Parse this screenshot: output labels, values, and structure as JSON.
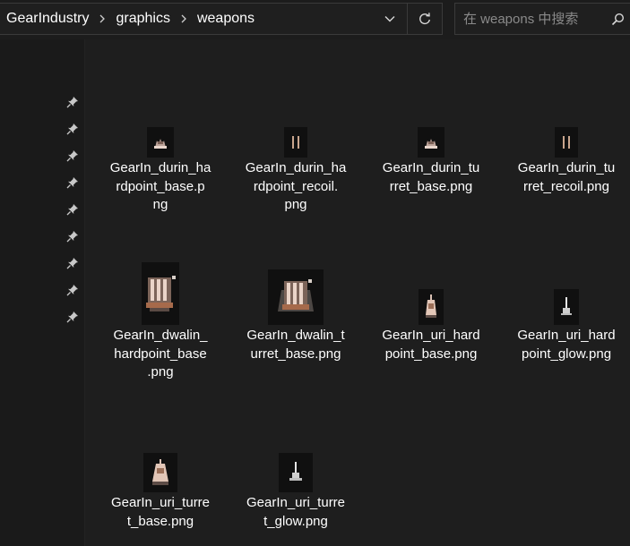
{
  "address_bar": {
    "breadcrumbs": [
      "GearIndustry",
      "graphics",
      "weapons"
    ],
    "dropdown_icon": "chevron-down-icon",
    "refresh_icon": "refresh-icon"
  },
  "search": {
    "placeholder": "在 weapons 中搜索",
    "value": "",
    "icon": "search-icon"
  },
  "nav_pane": {
    "pinned_count": 9,
    "pin_icon": "pin-icon"
  },
  "files": [
    {
      "name": "GearIn_durin_hardpoint_base.png",
      "lines": [
        "GearIn_durin_ha",
        "rdpoint_base.p",
        "ng"
      ]
    },
    {
      "name": "GearIn_durin_hardpoint_recoil.png",
      "lines": [
        "GearIn_durin_ha",
        "rdpoint_recoil.",
        "png"
      ]
    },
    {
      "name": "GearIn_durin_turret_base.png",
      "lines": [
        "GearIn_durin_tu",
        "rret_base.png"
      ]
    },
    {
      "name": "GearIn_durin_turret_recoil.png",
      "lines": [
        "GearIn_durin_tu",
        "rret_recoil.png"
      ]
    },
    {
      "name": "GearIn_dwalin_hardpoint_base.png",
      "lines": [
        "GearIn_dwalin_",
        "hardpoint_base",
        ".png"
      ]
    },
    {
      "name": "GearIn_dwalin_turret_base.png",
      "lines": [
        "GearIn_dwalin_t",
        "urret_base.png"
      ]
    },
    {
      "name": "GearIn_uri_hardpoint_base.png",
      "lines": [
        "GearIn_uri_hard",
        "point_base.png"
      ]
    },
    {
      "name": "GearIn_uri_hardpoint_glow.png",
      "lines": [
        "GearIn_uri_hard",
        "point_glow.png"
      ]
    },
    {
      "name": "GearIn_uri_turret_base.png",
      "lines": [
        "GearIn_uri_turre",
        "t_base.png"
      ]
    },
    {
      "name": "GearIn_uri_turret_glow.png",
      "lines": [
        "GearIn_uri_turre",
        "t_glow.png"
      ]
    }
  ],
  "colors": {
    "background": "#191919",
    "content_background": "#1e1e1e",
    "text": "#ffffff",
    "placeholder": "#8a8a8a",
    "border": "#3a3a3a"
  }
}
